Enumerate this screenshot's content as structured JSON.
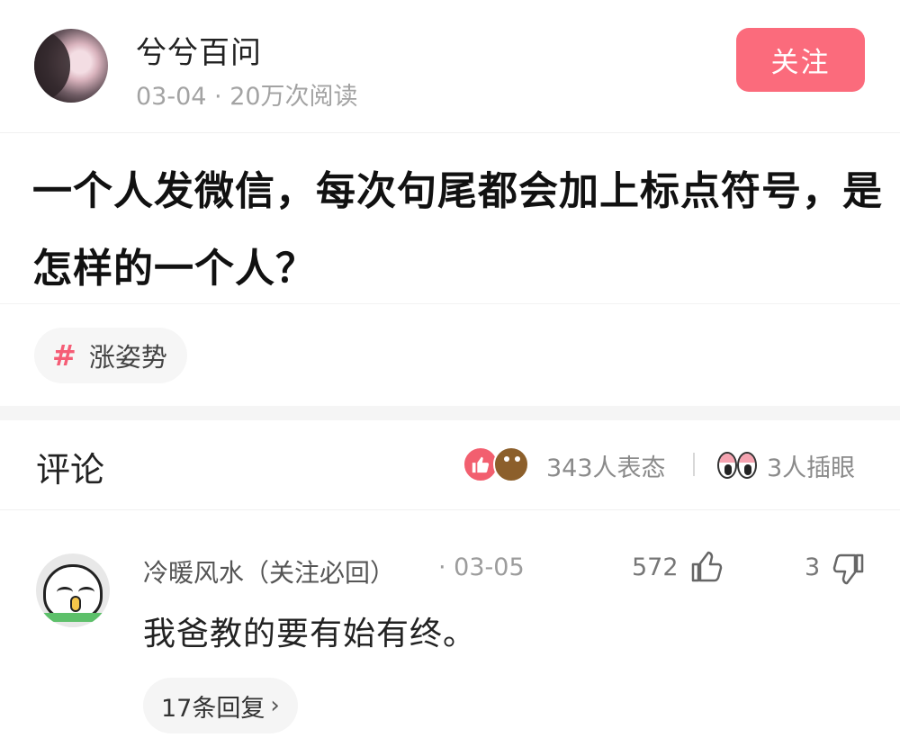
{
  "author": {
    "name": "兮兮百问",
    "meta": "03-04 · 20万次阅读",
    "follow_label": "关注"
  },
  "post": {
    "title": "一个人发微信，每次句尾都会加上标点符号，是怎样的一个人？"
  },
  "tag": {
    "icon": "hash-icon",
    "label": "涨姿势"
  },
  "comments_header": {
    "title": "评论",
    "reactions_text": "343人表态",
    "eye_text": "3人插眼"
  },
  "comment": {
    "author": "冷暖风水（关注必回）",
    "date": "· 03-05",
    "likes": "572",
    "dislikes": "3",
    "text": "我爸教的要有始有终。",
    "replies_label": "17条回复"
  },
  "colors": {
    "accent": "#fb6b7c",
    "tag_hash": "#f55d76"
  }
}
